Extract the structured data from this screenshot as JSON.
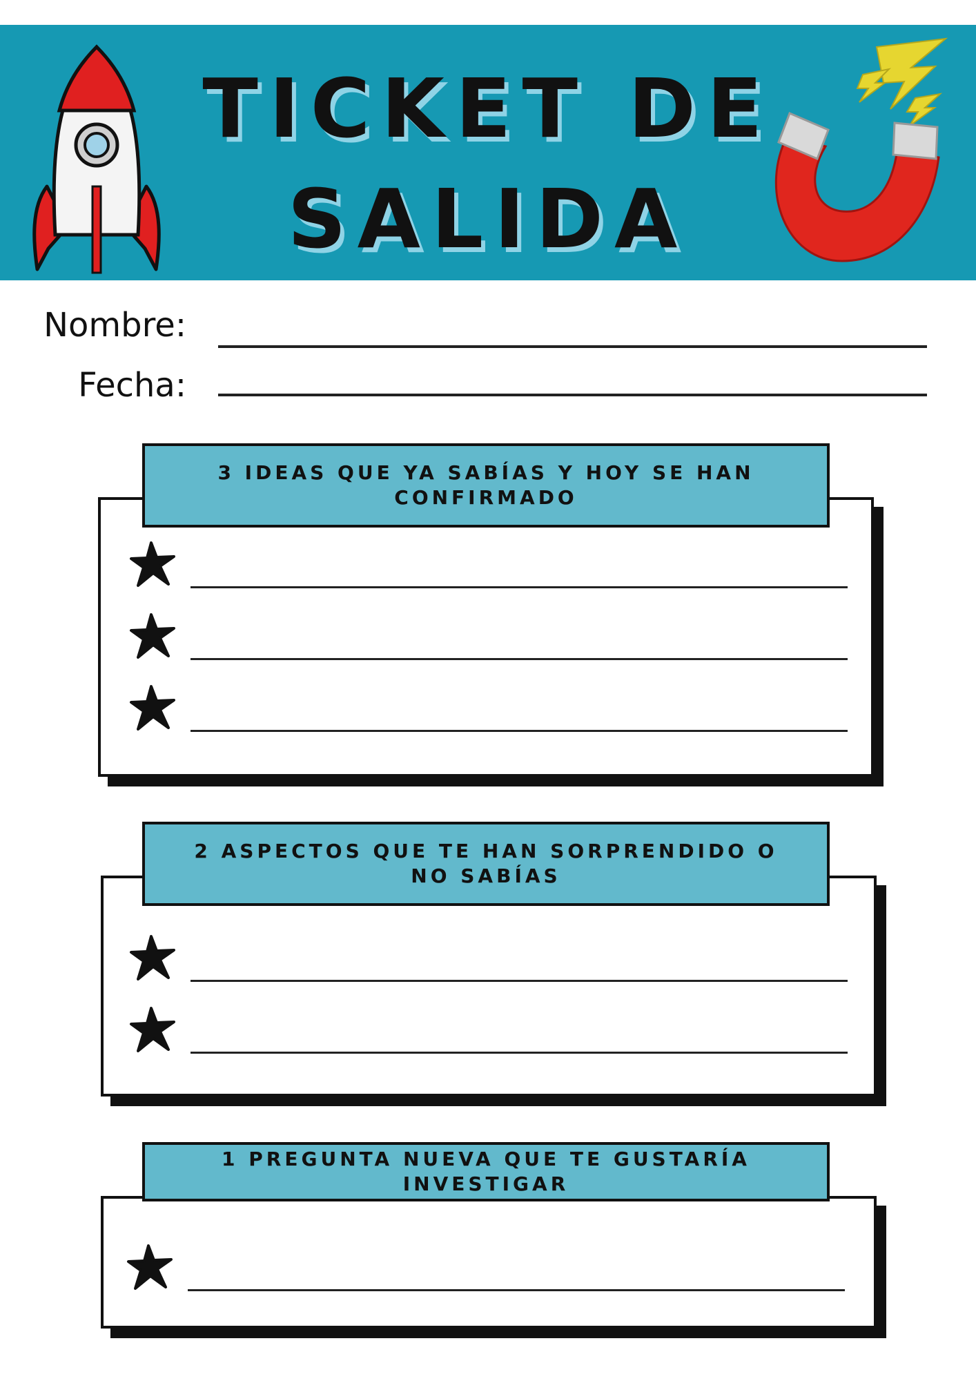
{
  "header": {
    "title_line1": "TICKET DE",
    "title_line2": "SALIDA",
    "banner_color": "#1699b3",
    "icons": [
      "rocket-icon",
      "magnet-icon"
    ]
  },
  "fields": {
    "name_label": "Nombre:",
    "date_label": "Fecha:"
  },
  "sections": [
    {
      "title": "3 IDEAS QUE YA SABÍAS Y HOY SE HAN CONFIRMADO",
      "lines": 3
    },
    {
      "title": "2 ASPECTOS QUE TE HAN SORPRENDIDO O NO SABÍAS",
      "lines": 2
    },
    {
      "title": "1 PREGUNTA NUEVA QUE TE GUSTARÍA INVESTIGAR",
      "lines": 1
    }
  ],
  "colors": {
    "header_box": "#62b9cc",
    "ink": "#111111"
  }
}
